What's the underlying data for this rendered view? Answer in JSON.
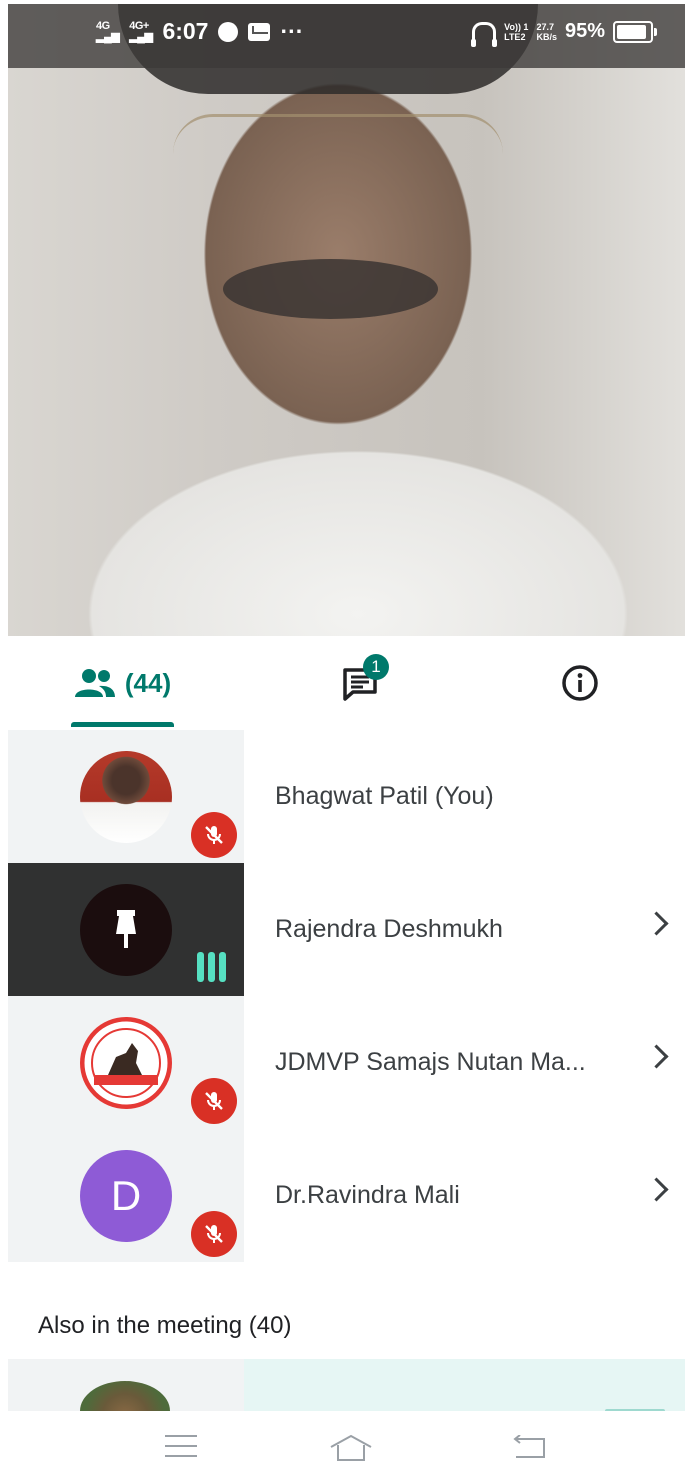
{
  "status_bar": {
    "network1": "4G",
    "network2": "4G+",
    "time": "6:07",
    "more": "···",
    "volte": "Vo)) 1",
    "lte": "LTE2",
    "speed_value": "27.7",
    "speed_unit": "KB/s",
    "battery_percent": "95%",
    "battery_level": 0.95
  },
  "tabs": {
    "people_count": "(44)",
    "chat_badge": "1"
  },
  "participants": [
    {
      "name": "Bhagwat Patil (You)",
      "muted": true,
      "speaking": false,
      "avatar": "photo"
    },
    {
      "name": "Rajendra Deshmukh",
      "muted": false,
      "speaking": true,
      "avatar": "pin-icon"
    },
    {
      "name": "JDMVP Samajs Nutan Ma...",
      "muted": true,
      "speaking": false,
      "avatar": "logo"
    },
    {
      "name": "Dr.Ravindra Mali",
      "muted": true,
      "speaking": false,
      "avatar_letter": "D"
    }
  ],
  "also_in_meeting": "Also in the meeting (40)",
  "colors": {
    "accent": "#00796b",
    "mute_red": "#d93025",
    "speaking_green": "#56e0c2",
    "avatar_purple": "#8e5bd6"
  }
}
